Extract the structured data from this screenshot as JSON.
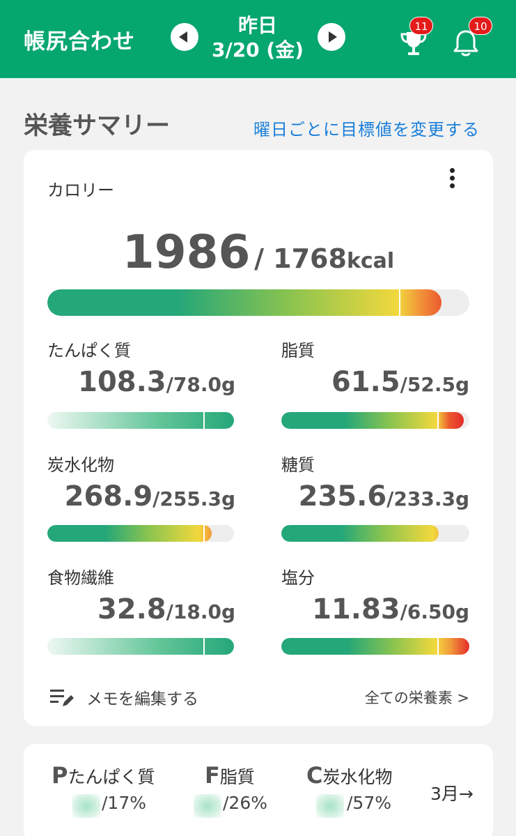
{
  "header": {
    "title": "帳尻合わせ",
    "date_day": "昨日",
    "date_full": "3/20 (金)",
    "trophy_badge": "11",
    "bell_badge": "10",
    "color": "#06a66f"
  },
  "summary": {
    "title": "栄養サマリー",
    "link": "曜日ごとに目標値を変更する"
  },
  "calorie": {
    "label": "カロリー",
    "value": "1986",
    "target": "/ 1768",
    "unit": "kcal",
    "progress": 1.123
  },
  "nutrients": [
    {
      "name": "たんぱく質",
      "value": "108.3",
      "target": "/78.0g",
      "progress": 1.39
    },
    {
      "name": "脂質",
      "value": "61.5",
      "target": "/52.5g",
      "progress": 1.17
    },
    {
      "name": "炭水化物",
      "value": "268.9",
      "target": "/255.3g",
      "progress": 1.05
    },
    {
      "name": "糖質",
      "value": "235.6",
      "target": "/233.3g",
      "progress": 1.01
    },
    {
      "name": "食物繊維",
      "value": "32.8",
      "target": "/18.0g",
      "progress": 1.82
    },
    {
      "name": "塩分",
      "value": "11.83",
      "target": "/6.50g",
      "progress": 1.82
    }
  ],
  "footer": {
    "memo": "メモを編集する",
    "all": "全ての栄養素 >"
  },
  "pfc": {
    "items": [
      {
        "letter": "P",
        "name": "たんぱく質",
        "pct": "/17%"
      },
      {
        "letter": "F",
        "name": "脂質",
        "pct": "/26%"
      },
      {
        "letter": "C",
        "name": "炭水化物",
        "pct": "/57%"
      }
    ],
    "month": "3月→"
  }
}
